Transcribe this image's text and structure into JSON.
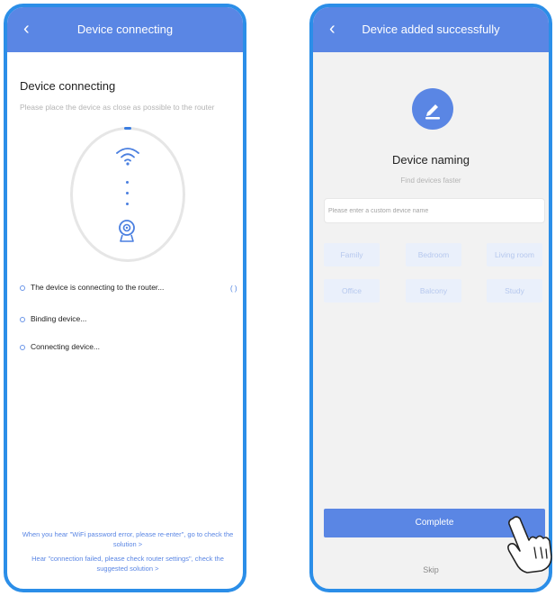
{
  "left_screen": {
    "nav_title": "Device connecting",
    "heading": "Device connecting",
    "subtitle": "Please place the device as close as possible to the router",
    "steps": [
      "The device is connecting to the router...",
      "Binding device...",
      "Connecting device..."
    ],
    "spinner": "( )",
    "help_links": [
      "When you hear \"WiFi password error, please re-enter\", go to check the solution >",
      "Hear \"connection failed, please check router settings\", check the suggested solution >"
    ]
  },
  "right_screen": {
    "nav_title": "Device added successfully",
    "title": "Device naming",
    "subtitle": "Find devices faster",
    "input_placeholder": "Please enter a custom device name",
    "input_value": "",
    "chips": [
      "Family",
      "Bedroom",
      "Living room",
      "Office",
      "Balcony",
      "Study"
    ],
    "complete_label": "Complete",
    "skip_label": "Skip"
  },
  "icons": {
    "back": "chevron-left-icon",
    "wifi": "wifi-icon",
    "camera": "camera-icon",
    "edit": "pencil-icon",
    "hand": "pointing-hand-icon"
  },
  "colors": {
    "accent": "#5a86e4",
    "frame": "#2b8ee8",
    "chip_bg": "#eaf0fb",
    "chip_text": "#b6c8ee"
  }
}
